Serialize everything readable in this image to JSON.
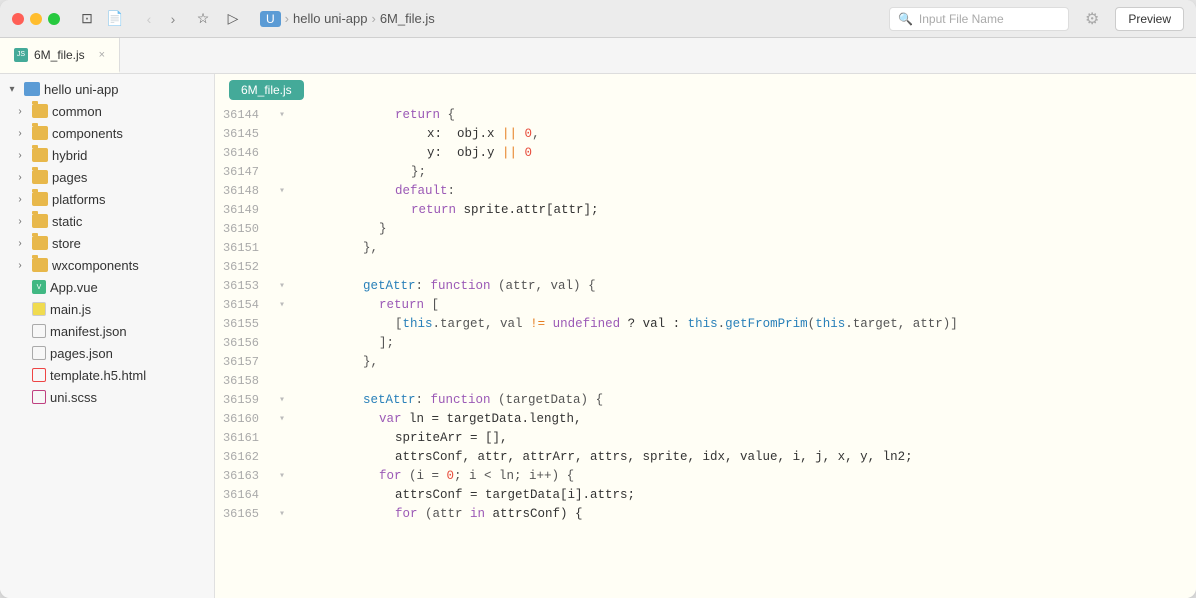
{
  "window": {
    "title": "hello uni-app — 6M_file.js"
  },
  "titlebar": {
    "traffic": [
      "close",
      "minimize",
      "maximize"
    ],
    "actions": [
      "save-icon",
      "file-icon",
      "star-icon",
      "play-icon"
    ],
    "breadcrumb": [
      "hello uni-app",
      "6M_file.js"
    ],
    "search_placeholder": "Input File Name",
    "preview_label": "Preview"
  },
  "tabs": [
    {
      "label": "6M_file.js",
      "active": true,
      "type": "js"
    },
    {
      "label": "Input File Name",
      "active": false,
      "type": "search"
    }
  ],
  "sidebar": {
    "root": "hello uni-app",
    "items": [
      {
        "label": "common",
        "type": "folder",
        "indent": 1,
        "expanded": false
      },
      {
        "label": "components",
        "type": "folder",
        "indent": 1,
        "expanded": false
      },
      {
        "label": "hybrid",
        "type": "folder",
        "indent": 1,
        "expanded": false
      },
      {
        "label": "pages",
        "type": "folder",
        "indent": 1,
        "expanded": false
      },
      {
        "label": "platforms",
        "type": "folder",
        "indent": 1,
        "expanded": false
      },
      {
        "label": "static",
        "type": "folder",
        "indent": 1,
        "expanded": false
      },
      {
        "label": "store",
        "type": "folder",
        "indent": 1,
        "expanded": false
      },
      {
        "label": "wxcomponents",
        "type": "folder",
        "indent": 1,
        "expanded": false
      },
      {
        "label": "App.vue",
        "type": "vue",
        "indent": 1
      },
      {
        "label": "main.js",
        "type": "js",
        "indent": 1
      },
      {
        "label": "manifest.json",
        "type": "json",
        "indent": 1
      },
      {
        "label": "pages.json",
        "type": "json",
        "indent": 1
      },
      {
        "label": "template.h5.html",
        "type": "html",
        "indent": 1
      },
      {
        "label": "uni.scss",
        "type": "scss",
        "indent": 1
      }
    ]
  },
  "editor": {
    "filename": "6M_file.js",
    "lines": [
      {
        "num": "36144",
        "fold": "▾",
        "code": "return {"
      },
      {
        "num": "36145",
        "fold": "",
        "code": "x:  obj.x || 0,"
      },
      {
        "num": "36146",
        "fold": "",
        "code": "y:  obj.y || 0"
      },
      {
        "num": "36147",
        "fold": "",
        "code": "};"
      },
      {
        "num": "36148",
        "fold": "▾",
        "code": "default:"
      },
      {
        "num": "36149",
        "fold": "",
        "code": "return sprite.attr[attr];"
      },
      {
        "num": "36150",
        "fold": "",
        "code": "}"
      },
      {
        "num": "36151",
        "fold": "",
        "code": "},"
      },
      {
        "num": "36152",
        "fold": "",
        "code": ""
      },
      {
        "num": "36153",
        "fold": "▾",
        "code": "getAttr: function (attr, val) {"
      },
      {
        "num": "36154",
        "fold": "▾",
        "code": "return ["
      },
      {
        "num": "36155",
        "fold": "",
        "code": "[this.target, val != undefined ? val : this.getFromPrim(this.target, attr)]"
      },
      {
        "num": "36156",
        "fold": "",
        "code": "];"
      },
      {
        "num": "36157",
        "fold": "",
        "code": "},"
      },
      {
        "num": "36158",
        "fold": "",
        "code": ""
      },
      {
        "num": "36159",
        "fold": "▾",
        "code": "setAttr: function (targetData) {"
      },
      {
        "num": "36160",
        "fold": "▾",
        "code": "var ln = targetData.length,"
      },
      {
        "num": "36161",
        "fold": "",
        "code": "spriteArr = [],"
      },
      {
        "num": "36162",
        "fold": "",
        "code": "attrsConf, attr, attrArr, attrs, sprite, idx, value, i, j, x, y, ln2;"
      },
      {
        "num": "36163",
        "fold": "▾",
        "code": "for (i = 0; i < ln; i++) {"
      },
      {
        "num": "36164",
        "fold": "",
        "code": "attrsConf = targetData[i].attrs;"
      },
      {
        "num": "36165",
        "fold": "▾",
        "code": "for (attr in attrsConf) {"
      }
    ]
  }
}
